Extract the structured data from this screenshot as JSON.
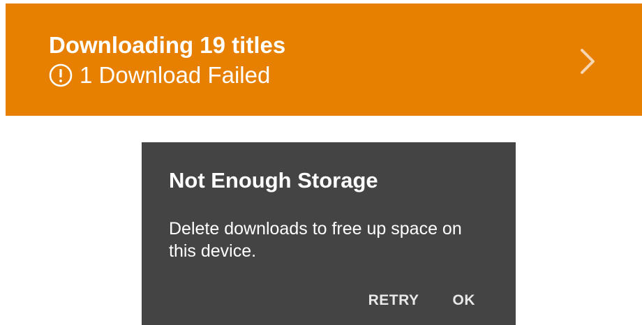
{
  "banner": {
    "title": "Downloading 19 titles",
    "status": "1 Download Failed",
    "status_icon": "alert-circle-icon",
    "nav_icon": "chevron-right-icon",
    "background_color": "#e77f00"
  },
  "dialog": {
    "title": "Not Enough Storage",
    "message": "Delete downloads to free up space on this device.",
    "retry_label": "RETRY",
    "ok_label": "OK",
    "background_color": "#444444"
  }
}
